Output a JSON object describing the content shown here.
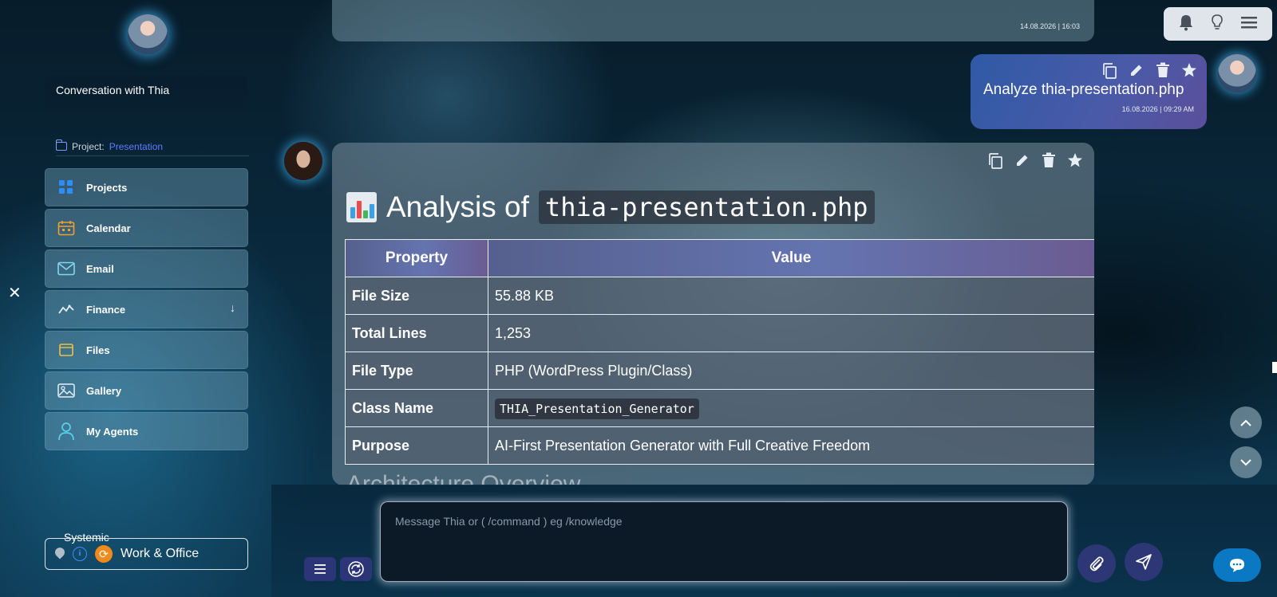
{
  "sidebar": {
    "conversation_title": "Conversation with Thia",
    "project_label": "Project:",
    "project_value": "Presentation",
    "items": [
      {
        "label": "Projects",
        "icon": "grid-icon"
      },
      {
        "label": "Calendar",
        "icon": "calendar-icon"
      },
      {
        "label": "Email",
        "icon": "mail-icon"
      },
      {
        "label": "Finance",
        "icon": "chart-line-icon"
      },
      {
        "label": "Files",
        "icon": "folder-icon"
      },
      {
        "label": "Gallery",
        "icon": "image-icon"
      },
      {
        "label": "My Agents",
        "icon": "person-icon"
      }
    ],
    "close_glyph": "✕",
    "mode_caption": "Systemic",
    "mode_label": "Work & Office"
  },
  "messages": {
    "prev_timestamp": "14.08.2026 | 16:03",
    "user_text": "Analyze thia-presentation.php",
    "user_timestamp": "16.08.2026 | 09:29 AM",
    "ai_title_prefix": "Analysis of",
    "ai_title_code": "thia-presentation.php",
    "table_headers": [
      "Property",
      "Value"
    ],
    "rows": [
      {
        "key": "File Size",
        "value": "55.88 KB",
        "code": false
      },
      {
        "key": "Total Lines",
        "value": "1,253",
        "code": false
      },
      {
        "key": "File Type",
        "value": "PHP (WordPress Plugin/Class)",
        "code": false
      },
      {
        "key": "Class Name",
        "value": "THIA_Presentation_Generator",
        "code": true
      },
      {
        "key": "Purpose",
        "value": "AI-First Presentation Generator with Full Creative Freedom",
        "code": false
      }
    ],
    "next_heading": "Architecture Overview"
  },
  "composer": {
    "placeholder": "Message Thia or ( /command ) eg /knowledge"
  },
  "colors": {
    "accent_blue": "#0a78c2",
    "project_link": "#5d7cff",
    "button_navy": "#2d3775"
  }
}
